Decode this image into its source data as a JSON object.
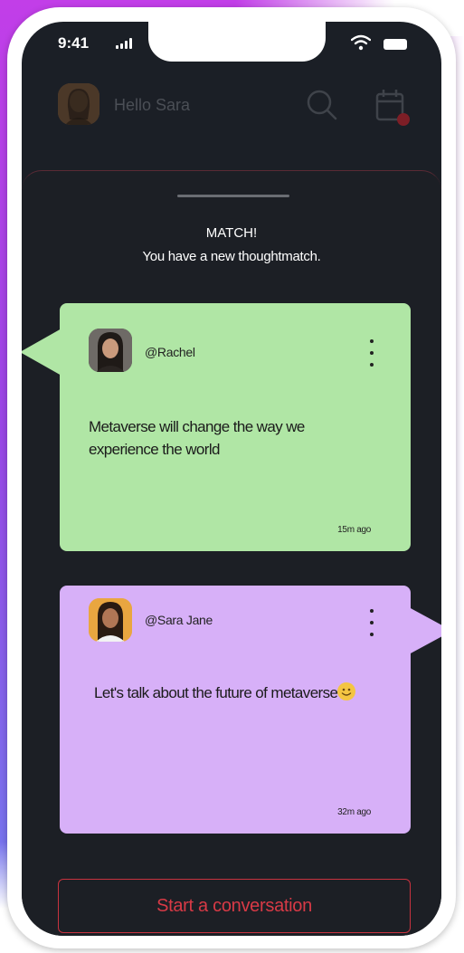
{
  "status_bar": {
    "time": "9:41"
  },
  "header": {
    "greeting": "Hello Sara"
  },
  "sheet": {
    "title": "MATCH!",
    "subtitle": "You have a new thoughtmatch."
  },
  "cards": [
    {
      "handle": "@Rachel",
      "text": "Metaverse will change the way we experience the world",
      "time": "15m ago",
      "color": "#b0e6a5"
    },
    {
      "handle": "@Sara Jane",
      "text": "Let's talk about the future of metaverse",
      "time": "32m ago",
      "color": "#d7b0f8"
    }
  ],
  "cta": {
    "label": "Start a conversation"
  },
  "colors": {
    "screen_bg": "#1b1f26",
    "accent_red": "#d83a46",
    "card_green": "#b0e6a5",
    "card_purple": "#d7b0f8"
  },
  "icons": [
    "signal-icon",
    "wifi-icon",
    "battery-icon",
    "search-icon",
    "calendar-icon",
    "kebab-menu-icon",
    "smile-emoji-icon"
  ]
}
